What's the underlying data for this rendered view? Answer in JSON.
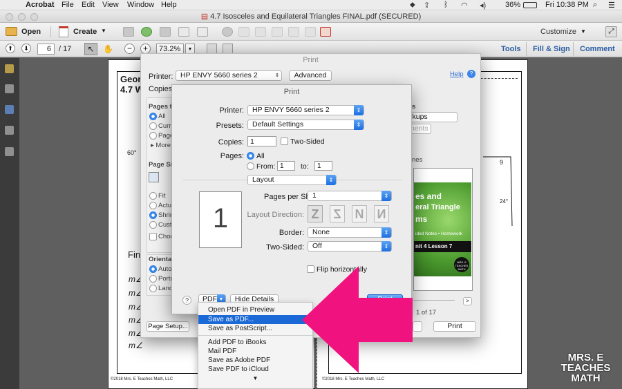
{
  "menubar": {
    "app": "Acrobat",
    "items": [
      "File",
      "Edit",
      "View",
      "Window",
      "Help"
    ],
    "battery": "36%",
    "clock": "Fri 10:38 PM"
  },
  "window": {
    "title": "4.7 Isosceles and Equilateral Triangles FINAL.pdf (SECURED)"
  },
  "toolbar": {
    "open": "Open",
    "create": "Create",
    "customize": "Customize"
  },
  "nav": {
    "page_current": "6",
    "page_total": "/ 17",
    "zoom": "73.2%"
  },
  "right_tabs": {
    "tools": "Tools",
    "fill_sign": "Fill & Sign",
    "comment": "Comment"
  },
  "doc": {
    "left_title_1": "Geor",
    "left_title_2": "4.7 W",
    "angle_60": "60°",
    "fin": "Fin",
    "m_lines": [
      "m∠",
      "m∠",
      "m∠",
      "m∠",
      "m∠",
      "m∠"
    ],
    "footer_left": "©2018 Mrs. E Teaches Math, LLC",
    "footer_right": "©2018 Mrs. E Teaches Math, LLC",
    "right_9": "9",
    "right_24": "24°"
  },
  "print_back": {
    "title": "Print",
    "printer_label": "Printer:",
    "printer": "HP ENVY 5660 series 2",
    "advanced": "Advanced",
    "help": "Help",
    "copies_label": "Copies:",
    "pages_to": "Pages to",
    "opt_all": "All",
    "opt_curr": "Curre",
    "opt_pages": "Pages",
    "opt_more": "More",
    "page_size": "Page Siz",
    "opt_fit": "Fit",
    "opt_actual": "Actua",
    "opt_shrink": "Shrin",
    "opt_custom": "Custo",
    "opt_choose": "Choos",
    "orientation": "Orientati",
    "opt_auto": "Auto p",
    "opt_portrait": "Portra",
    "opt_landscape": "Lands",
    "page_setup": "Page Setup...",
    "s_right": "s",
    "markups": "rkups",
    "comments": "ments",
    "preview_label": "nes",
    "preview_line1": "es and",
    "preview_line2": "eral Triangle",
    "preview_line3": "ms",
    "preview_line4": "ided Notes • Homework",
    "preview_line5": "nit 4 Lesson 7",
    "preview_badge": "MRS. E TEACHES MATH",
    "page_of": "1 of 17",
    "next": ">",
    "print_btn": "Print"
  },
  "print_front": {
    "title": "Print",
    "printer_label": "Printer:",
    "printer": "HP ENVY 5660 series 2",
    "presets_label": "Presets:",
    "presets": "Default Settings",
    "copies_label": "Copies:",
    "copies": "1",
    "two_sided": "Two-Sided",
    "pages_label": "Pages:",
    "all": "All",
    "from": "From:",
    "from_val": "1",
    "to": "to:",
    "to_val": "1",
    "section": "Layout",
    "preview_num": "1",
    "pps_label": "Pages per Sheet:",
    "pps": "1",
    "layout_dir_label": "Layout Direction:",
    "border_label": "Border:",
    "border": "None",
    "two_sided_label": "Two-Sided:",
    "two_sided_val": "Off",
    "flip": "Flip horizontally",
    "question": "?",
    "pdf": "PDF",
    "hide_details": "Hide Details",
    "print": "Print"
  },
  "pdf_menu": {
    "items": [
      "Open PDF in Preview",
      "Save as PDF...",
      "Save as PostScript...",
      "Add PDF to iBooks",
      "Mail PDF",
      "Save as Adobe PDF",
      "Save PDF to iCloud"
    ],
    "more_arrow": "▼"
  },
  "watermark": {
    "line1": "MRS. E",
    "line2": "TEACHES",
    "line3": "MATH"
  },
  "colors": {
    "arrow": "#f0127e",
    "accent": "#1b69d6",
    "link": "#2d5fa4"
  }
}
